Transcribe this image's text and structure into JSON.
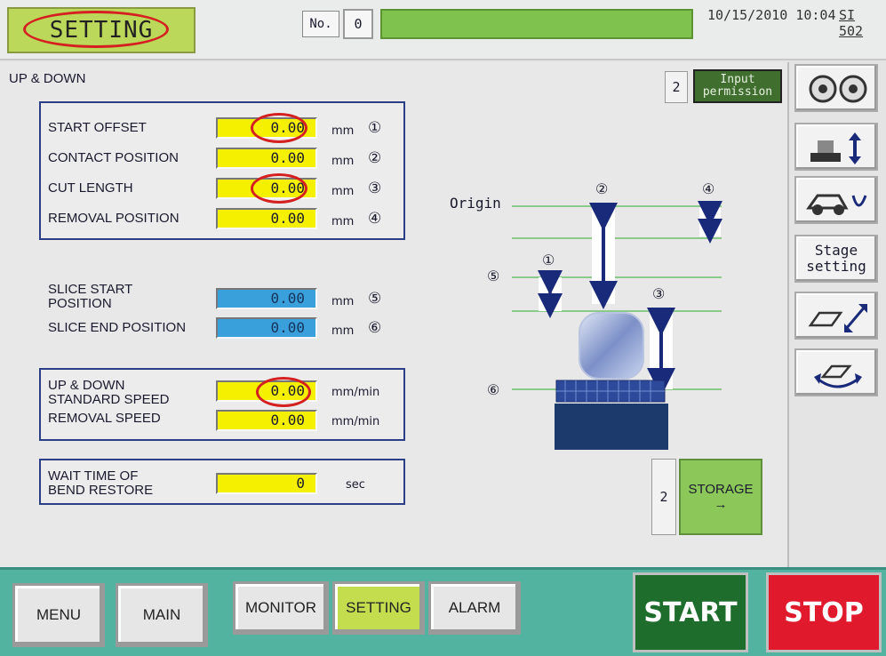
{
  "header": {
    "screen_title": "SETTING",
    "no_label": "No.",
    "no_value": "0",
    "datetime": "10/15/2010 10:04",
    "system_code": "SI 502"
  },
  "section_title": "UP & DOWN",
  "input_permission": {
    "count": "2",
    "label_line1": "Input",
    "label_line2": "permission"
  },
  "group1": {
    "rows": [
      {
        "label": "START OFFSET",
        "value": "0.00",
        "unit": "mm",
        "marker": "①"
      },
      {
        "label": "CONTACT POSITION",
        "value": "0.00",
        "unit": "mm",
        "marker": "②"
      },
      {
        "label": "CUT LENGTH",
        "value": "0.00",
        "unit": "mm",
        "marker": "③"
      },
      {
        "label": "REMOVAL POSITION",
        "value": "0.00",
        "unit": "mm",
        "marker": "④"
      }
    ]
  },
  "group2": {
    "rows": [
      {
        "label_line1": "SLICE START",
        "label_line2": "POSITION",
        "value": "0.00",
        "unit": "mm",
        "marker": "⑤"
      },
      {
        "label": "SLICE END POSITION",
        "value": "0.00",
        "unit": "mm",
        "marker": "⑥"
      }
    ]
  },
  "group3": {
    "rows": [
      {
        "label_line1": "UP & DOWN",
        "label_line2": "STANDARD SPEED",
        "value": "0.00",
        "unit": "mm/min"
      },
      {
        "label": "REMOVAL SPEED",
        "value": "0.00",
        "unit": "mm/min"
      }
    ]
  },
  "group4": {
    "label_line1": "WAIT TIME OF",
    "label_line2": "BEND RESTORE",
    "value": "0",
    "unit": "sec"
  },
  "diagram": {
    "origin_label": "Origin",
    "m1": "①",
    "m2": "②",
    "m3": "③",
    "m4": "④",
    "m5": "⑤",
    "m6": "⑥"
  },
  "storage": {
    "count": "2",
    "label": "STORAGE",
    "arrow": "→"
  },
  "side_buttons": {
    "stage_setting_line1": "Stage",
    "stage_setting_line2": "setting"
  },
  "bottom_nav": {
    "menu": "MENU",
    "main": "MAIN",
    "monitor": "MONITOR",
    "setting": "SETTING",
    "alarm": "ALARM",
    "start": "START",
    "stop": "STOP"
  },
  "colors": {
    "field_yellow": "#f4f000",
    "field_blue": "#3aa0dc",
    "active_green": "#c3dd4e",
    "start_green": "#1f6d2c",
    "stop_red": "#e01a2c",
    "bottom_bar": "#52b4a0",
    "annotation_red": "#d42020"
  }
}
